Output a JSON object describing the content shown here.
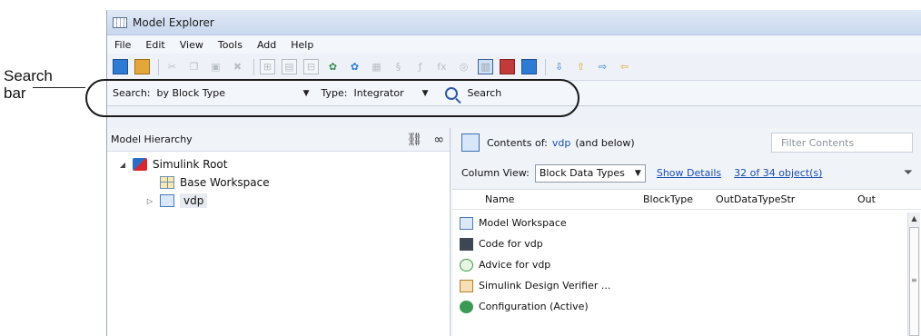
{
  "annotation": {
    "label_line1": "Search",
    "label_line2": "bar"
  },
  "window": {
    "title": "Model Explorer"
  },
  "menu": [
    "File",
    "Edit",
    "View",
    "Tools",
    "Add",
    "Help"
  ],
  "toolbar": {
    "icons": [
      "add-model-icon",
      "open-folder-icon",
      "cut-icon",
      "copy-icon",
      "paste-icon",
      "delete-icon",
      "add-grid-icon",
      "add-block-icon",
      "add-data-icon",
      "config-icon",
      "config-ref-icon",
      "layout-icon",
      "signal-icon",
      "function-icon",
      "fx-icon",
      "target-icon",
      "show-dialog-view-icon",
      "chart-icon",
      "tile-icon",
      "move-down-icon",
      "move-up-icon",
      "export-icon",
      "import-icon"
    ]
  },
  "search": {
    "search_label": "Search:",
    "search_by": "by Block Type",
    "type_label": "Type:",
    "type_value": "Integrator",
    "button_label": "Search"
  },
  "left_pane": {
    "header": "Model Hierarchy",
    "tree": [
      {
        "label": "Simulink Root"
      },
      {
        "label": "Base Workspace"
      },
      {
        "label": "vdp"
      }
    ]
  },
  "right_pane": {
    "contents_label": "Contents of:",
    "contents_target": "vdp",
    "contents_scope": "(and below)",
    "filter_placeholder": "Filter Contents",
    "column_view_label": "Column View:",
    "column_view_value": "Block Data Types",
    "show_details": "Show Details",
    "object_count": "32 of 34 object(s)",
    "columns": [
      "Name",
      "BlockType",
      "OutDataTypeStr",
      "Out"
    ],
    "rows": [
      {
        "name": "Model Workspace"
      },
      {
        "name": "Code for vdp"
      },
      {
        "name": "Advice for vdp"
      },
      {
        "name": "Simulink Design Verifier ..."
      },
      {
        "name": "Configuration (Active)"
      }
    ]
  }
}
